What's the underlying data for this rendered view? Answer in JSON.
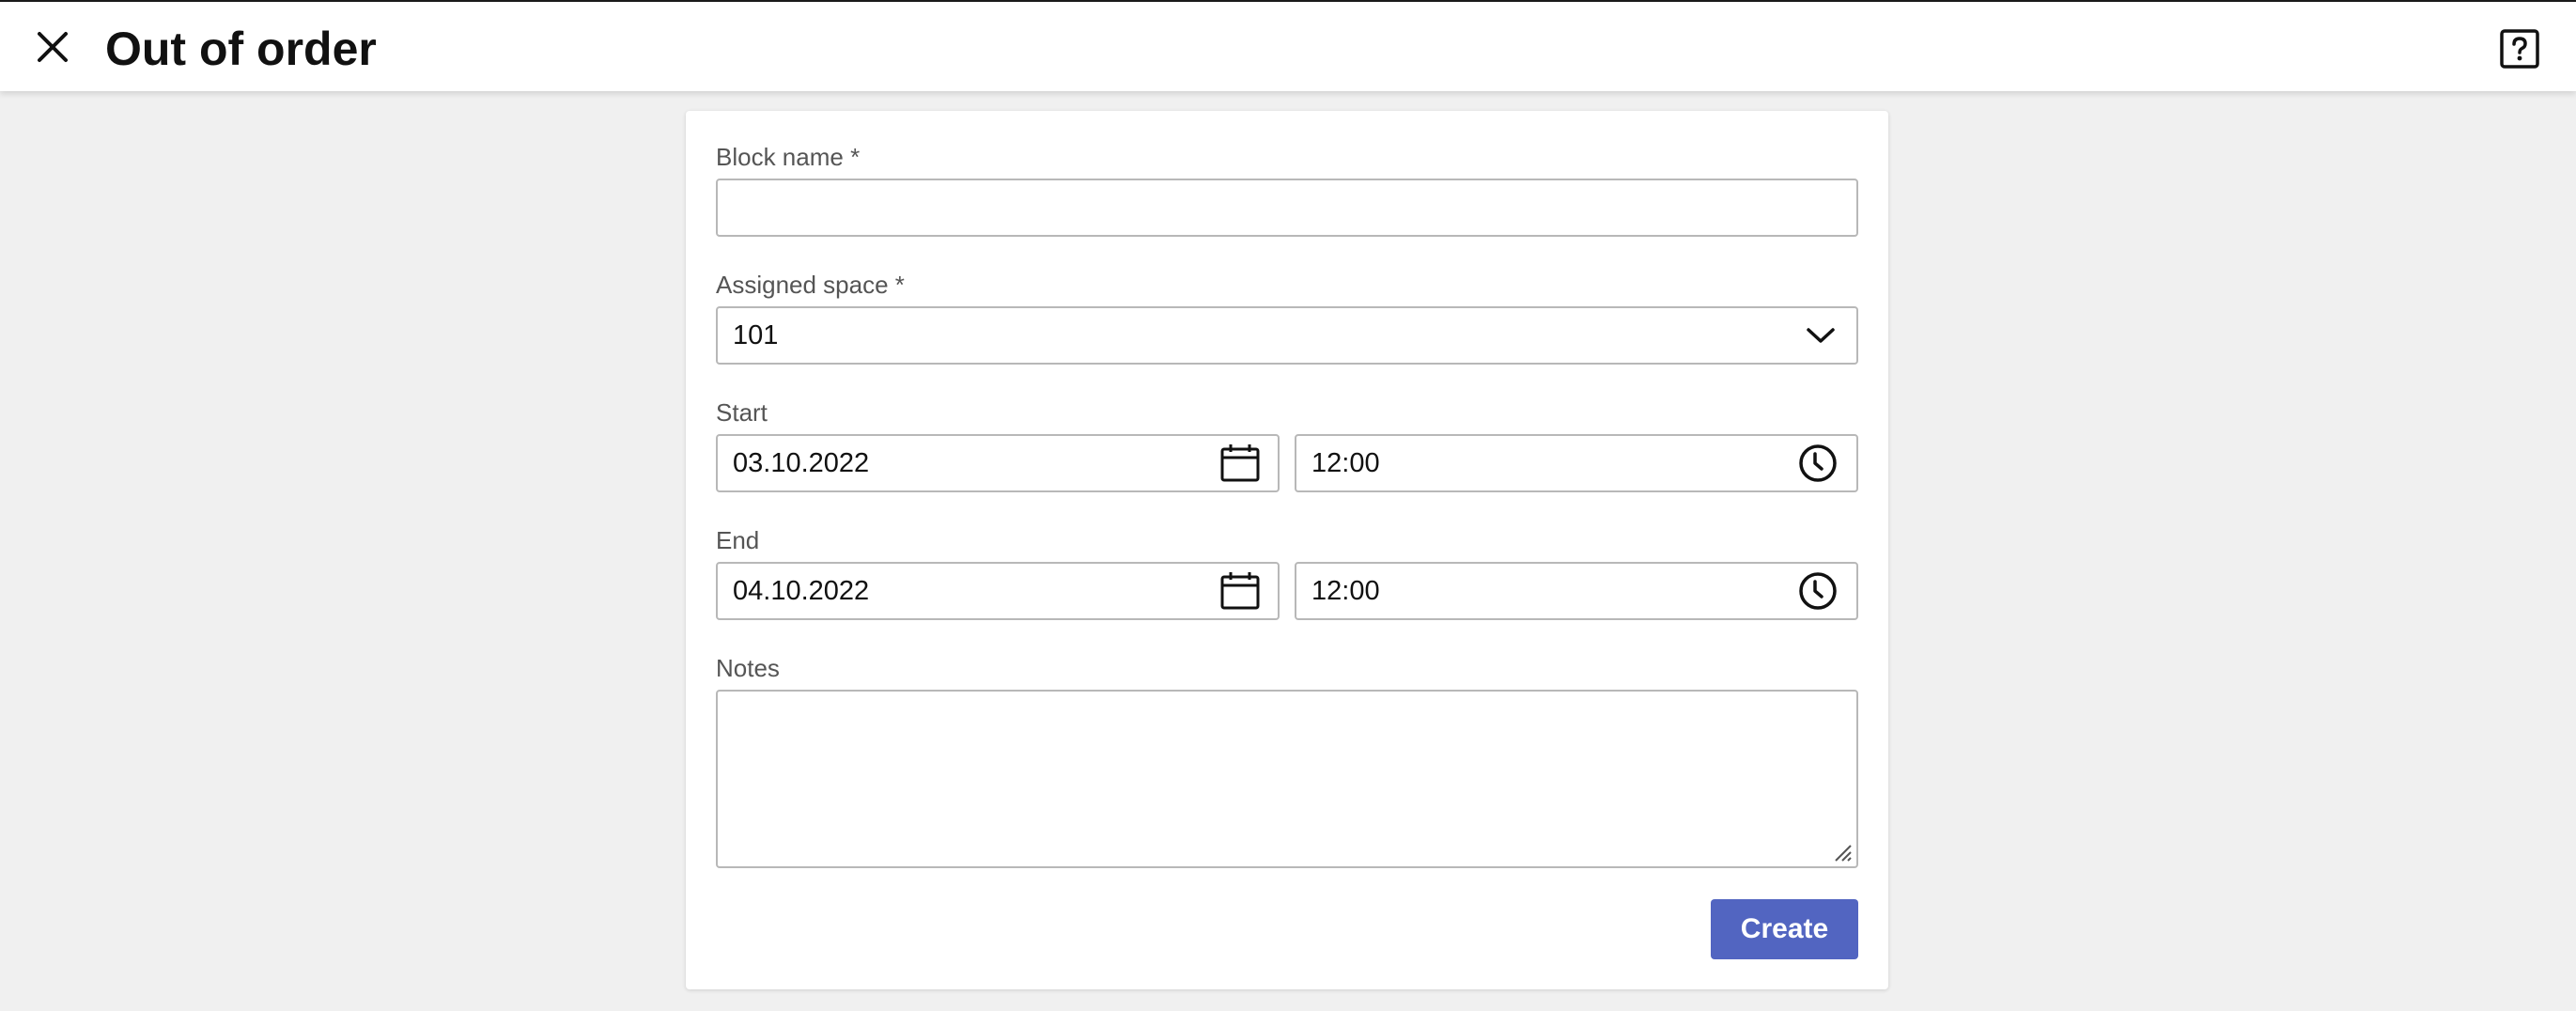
{
  "header": {
    "title": "Out of order",
    "close_icon": "close-icon",
    "help_icon": "help-icon"
  },
  "form": {
    "block_name": {
      "label": "Block name *",
      "value": ""
    },
    "assigned_space": {
      "label": "Assigned space *",
      "value": "101",
      "icon": "chevron-down-icon"
    },
    "start": {
      "label": "Start",
      "date": "03.10.2022",
      "time": "12:00",
      "date_icon": "calendar-icon",
      "time_icon": "clock-icon"
    },
    "end": {
      "label": "End",
      "date": "04.10.2022",
      "time": "12:00",
      "date_icon": "calendar-icon",
      "time_icon": "clock-icon"
    },
    "notes": {
      "label": "Notes",
      "value": ""
    },
    "create_label": "Create"
  },
  "colors": {
    "accent": "#5265c1",
    "background": "#f0f0f0",
    "card": "#ffffff",
    "border": "#b8b8b8"
  }
}
